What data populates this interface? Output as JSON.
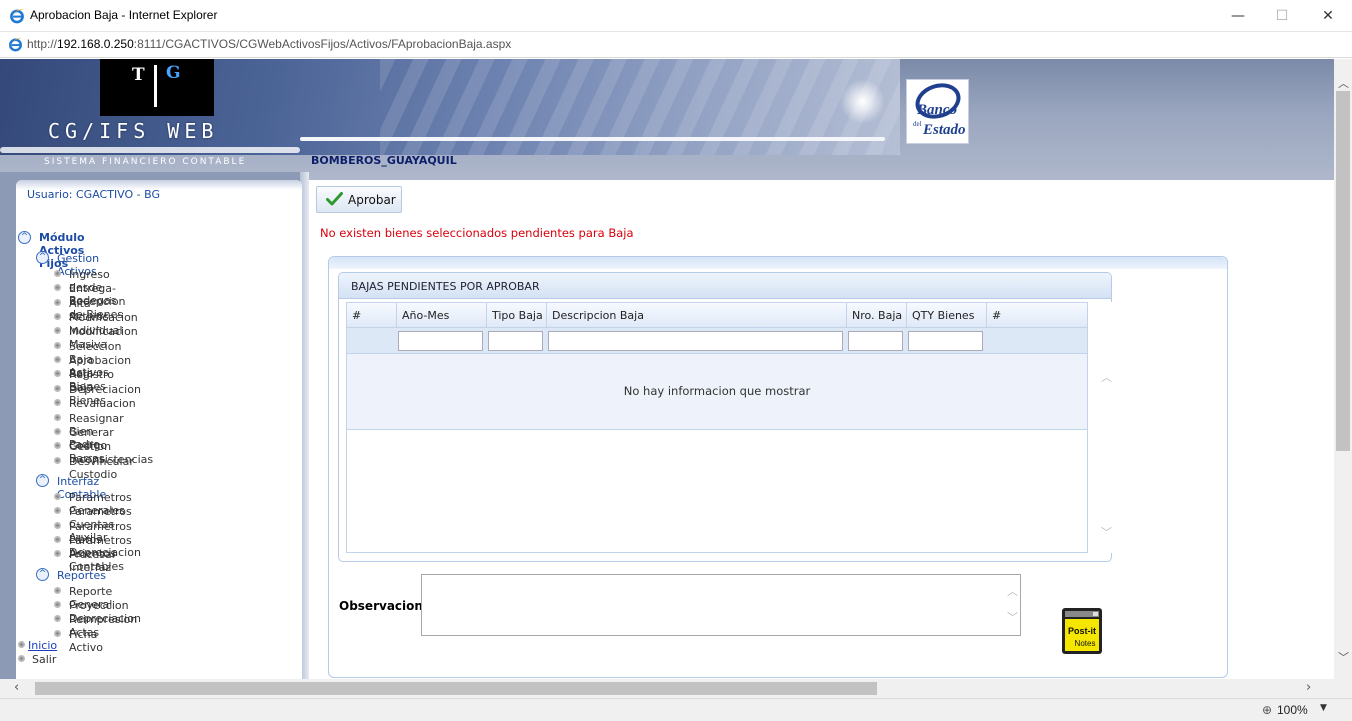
{
  "window": {
    "title": "Aprobacion Baja - Internet Explorer",
    "minimize": "—",
    "maximize": "☐",
    "close": "✕"
  },
  "address": {
    "prefix": "http://",
    "host": "192.168.0.250",
    "rest": ":8111/CGACTIVOS/CGWebActivosFijos/Activos/FAprobacionBaja.aspx"
  },
  "banner": {
    "logo_t": "T",
    "logo_g": "G",
    "app_name": "CG/IFS WEB",
    "app_subtitle": "SISTEMA FINANCIERO CONTABLE",
    "bank_line1": "Banco",
    "bank_line2": "del",
    "bank_line3": "Estado",
    "org_name": "BOMBEROS_GUAYAQUIL"
  },
  "sidebar": {
    "user": "Usuario: CGACTIVO - BG",
    "root_module": "Módulo Activos Fijos",
    "groups": [
      {
        "label": "Gestion Activos",
        "items": [
          "Ingreso desde Bodegas",
          "Entrega-Recepcion de Bienes",
          "Alta Activos",
          "Modificacion Individual",
          "Modificacion Masiva",
          "Seleccion Baja Activos",
          "Aprobacion Baja Bienes",
          "Registro Baja Bienes",
          "Depreciacion",
          "Revaluacion",
          "Reasignar Bien Padre",
          "Generar Codigo Barras",
          "Gestion Inconsistencias",
          "Desvincular Custodio"
        ]
      },
      {
        "label": "Interfaz Contable",
        "items": [
          "Parametros Generales",
          "Parametros Cuentas Auxilar",
          "Parametros Libros Depreciacion",
          "Parametros Asientos Contables",
          "Procesar Interfaz"
        ]
      },
      {
        "label": "Reportes",
        "items": [
          "Reporte General",
          "Proyeccion Depreciacion",
          "Reimpresion Actas",
          "Ficha Activo"
        ]
      }
    ],
    "links": [
      "Inicio",
      "Salir"
    ]
  },
  "main": {
    "approve_label": "Aprobar",
    "message": "No existen bienes seleccionados pendientes para Baja",
    "grid_title": "BAJAS PENDIENTES POR APROBAR",
    "columns": [
      "#",
      "Año-Mes",
      "Tipo Baja",
      "Descripcion Baja",
      "Nro. Baja",
      "QTY Bienes",
      "#"
    ],
    "filters": [
      "",
      "",
      "",
      "",
      ""
    ],
    "empty_text": "No hay informacion que mostrar",
    "obs_label": "Observacion:",
    "obs_value": "",
    "postit_line1": "Post-it",
    "postit_line2": "Notes"
  },
  "status": {
    "zoom": "100%"
  },
  "colors": {
    "link_blue": "#1c4ca3",
    "error_red": "#d8000c",
    "org_navy": "#0d1e6b",
    "grid_border": "#b5cbe8"
  }
}
